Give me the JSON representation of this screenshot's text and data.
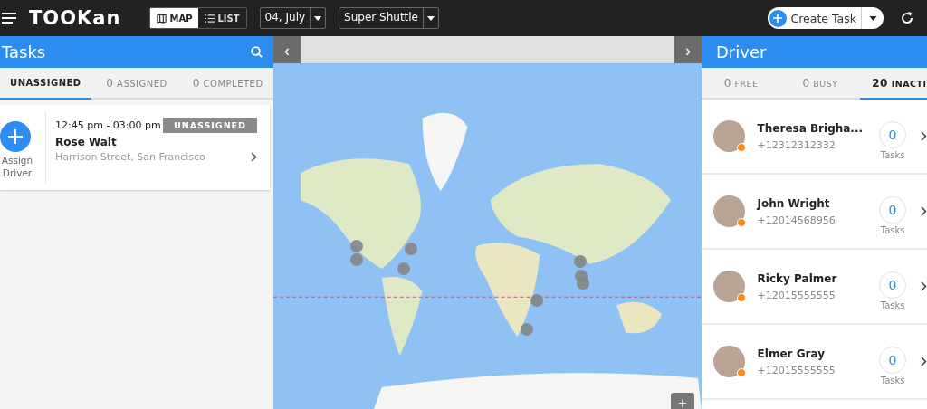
{
  "topbar": {
    "logo": "TOOKan",
    "views": [
      {
        "label": "MAP",
        "selected": true
      },
      {
        "label": "LIST",
        "selected": false
      }
    ],
    "date": "04, July",
    "fleet": "Super Shuttle",
    "create_button": "Create Task"
  },
  "tasks_panel": {
    "title": "Tasks",
    "tabs": [
      {
        "label": "UNASSIGNED",
        "selected": true
      },
      {
        "count": "0",
        "label": "ASSIGNED",
        "selected": false
      },
      {
        "count": "0",
        "label": "COMPLETED",
        "selected": false
      }
    ],
    "tasks": [
      {
        "assign_label": "Assign Driver",
        "time": "12:45 pm - 03:00 pm",
        "status": "UNASSIGNED",
        "name": "Rose Walt",
        "address": "Harrison Street, San Francisco"
      }
    ]
  },
  "map": {
    "prev": "‹",
    "next": "›",
    "zoom": "+"
  },
  "driver_panel": {
    "title": "Driver",
    "tabs": [
      {
        "count": "0",
        "label": "FREE",
        "selected": false
      },
      {
        "count": "0",
        "label": "BUSY",
        "selected": false
      },
      {
        "count": "20",
        "label": "INACTI",
        "selected": true
      }
    ],
    "drivers": [
      {
        "name": "Theresa Brigha...",
        "phone": "+12312312332",
        "tasks": "0",
        "tasks_label": "Tasks",
        "color": "#f28c1c"
      },
      {
        "name": "John Wright",
        "phone": "+12014568956",
        "tasks": "0",
        "tasks_label": "Tasks",
        "color": "#f28c1c"
      },
      {
        "name": "Ricky Palmer",
        "phone": "+12015555555",
        "tasks": "0",
        "tasks_label": "Tasks",
        "color": "#f28c1c"
      },
      {
        "name": "Elmer Gray",
        "phone": "+12015555555",
        "tasks": "0",
        "tasks_label": "Tasks",
        "color": "#f28c1c"
      }
    ]
  }
}
